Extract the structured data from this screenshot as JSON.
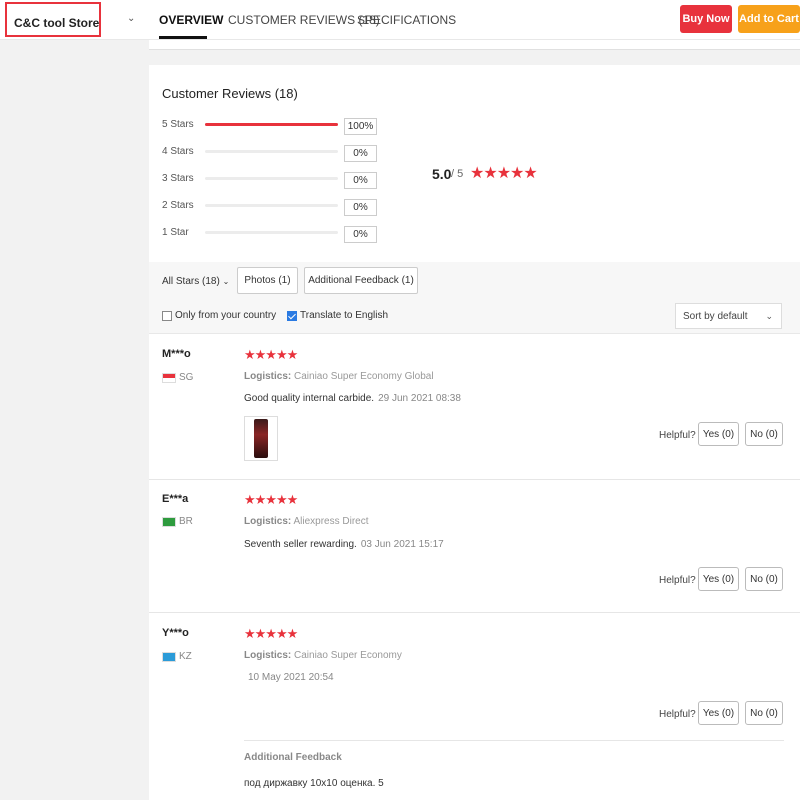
{
  "header": {
    "store_name": "C&C tool Store",
    "store_dropdown_icon": "chevron-down-icon",
    "tabs": [
      {
        "label": "OVERVIEW",
        "active": true
      },
      {
        "label": "CUSTOMER REVIEWS (18)",
        "active": false
      },
      {
        "label": "SPECIFICATIONS",
        "active": false
      }
    ],
    "buy_now": "Buy Now",
    "add_to_cart": "Add to Cart",
    "colors": {
      "buy_now": "#e8323c",
      "add_to_cart": "#f7a11a",
      "highlight": "#e8323c"
    }
  },
  "reviews_summary": {
    "title": "Customer Reviews (18)",
    "rows": [
      {
        "label": "5 Stars",
        "percent": "100%",
        "fraction": 1.0
      },
      {
        "label": "4 Stars",
        "percent": "0%",
        "fraction": 0
      },
      {
        "label": "3 Stars",
        "percent": "0%",
        "fraction": 0
      },
      {
        "label": "2 Stars",
        "percent": "0%",
        "fraction": 0
      },
      {
        "label": "1 Star",
        "percent": "0%",
        "fraction": 0
      }
    ],
    "average": "5.0",
    "out_of": "/ 5",
    "stars": "★★★★★"
  },
  "filters": {
    "all_stars": "All Stars (18)",
    "photos": "Photos (1)",
    "additional_feedback": "Additional Feedback (1)",
    "only_from_country": "Only from your country",
    "only_from_country_checked": false,
    "translate": "Translate to English",
    "translate_checked": true,
    "sort": "Sort by default"
  },
  "reviews": [
    {
      "user": "M***o",
      "country": "SG",
      "stars": "★★★★★",
      "logistics_label": "Logistics:",
      "logistics": "Cainiao Super Economy Global",
      "text": "Good quality internal carbide.",
      "date": "29 Jun 2021 08:38",
      "helpful": "Helpful?",
      "yes": "Yes (0)",
      "no": "No (0)"
    },
    {
      "user": "E***a",
      "country": "BR",
      "stars": "★★★★★",
      "logistics_label": "Logistics:",
      "logistics": "Aliexpress Direct",
      "text": "Seventh seller rewarding.",
      "date": "03 Jun 2021 15:17",
      "helpful": "Helpful?",
      "yes": "Yes (0)",
      "no": "No (0)"
    },
    {
      "user": "Y***o",
      "country": "KZ",
      "stars": "★★★★★",
      "logistics_label": "Logistics:",
      "logistics": "Cainiao Super Economy",
      "date": "10 May 2021 20:54",
      "helpful": "Helpful?",
      "yes": "Yes (0)",
      "no": "No (0)",
      "additional_feedback_title": "Additional Feedback",
      "additional_feedback_text": "под диржавку 10х10 оценка. 5"
    }
  ]
}
